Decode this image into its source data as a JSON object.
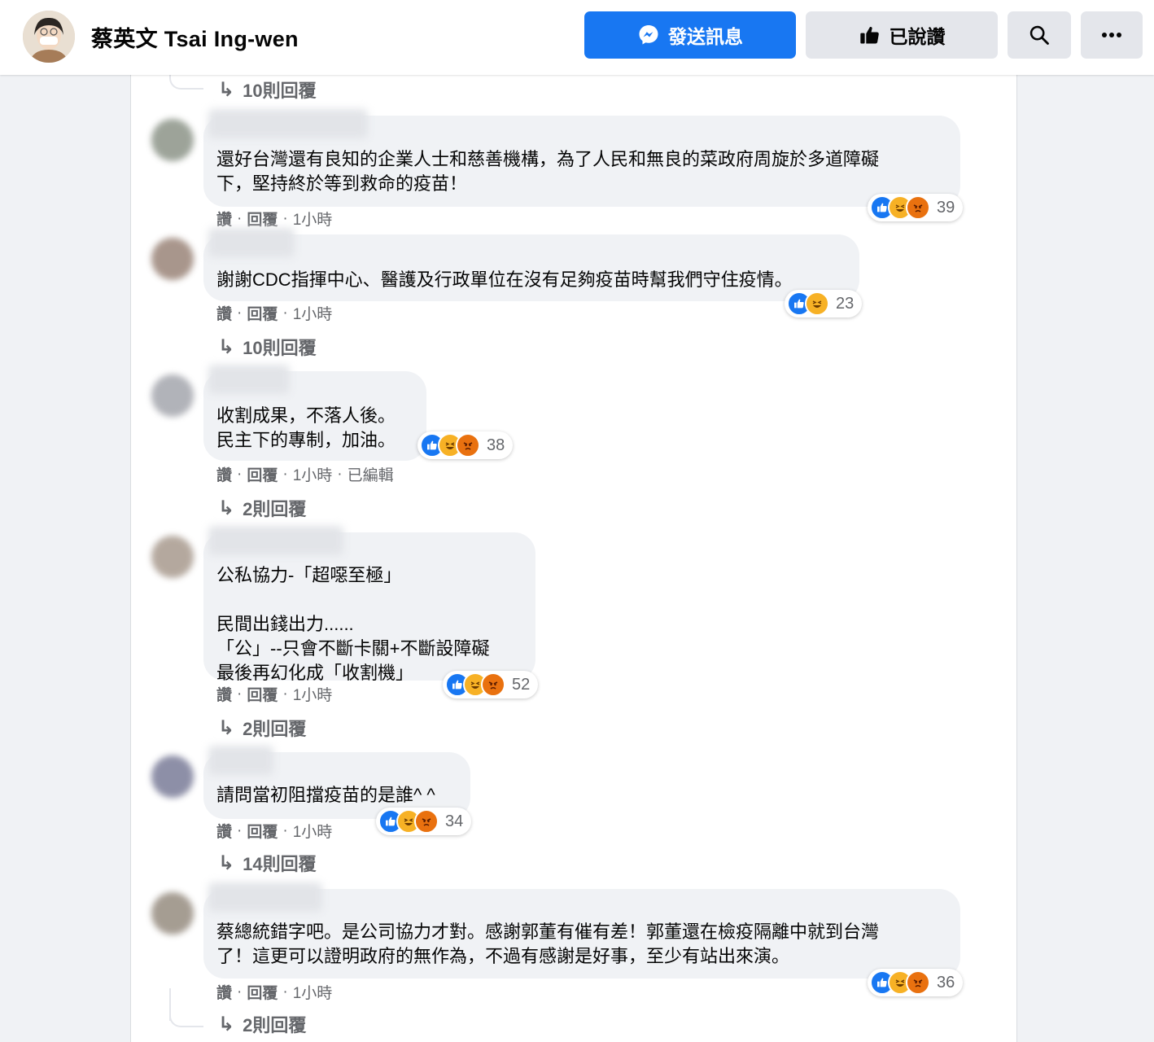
{
  "header": {
    "page_name": "蔡英文 Tsai Ing-wen",
    "message_button": "發送訊息",
    "liked_button": "已說讚",
    "search_icon": "search-icon",
    "more_icon": "more-icon"
  },
  "colors": {
    "accent": "#1877f2",
    "like": "#1877f2",
    "haha": "#f7b125",
    "angry": "#e9710f"
  },
  "top_replies": {
    "label": "10則回覆"
  },
  "comments": [
    {
      "text": "還好台灣還有良知的企業人士和慈善機構，為了人民和無良的菜政府周旋於多道障礙\n下，堅持終於等到救命的疫苗！",
      "reactions": [
        "like",
        "haha",
        "angry"
      ],
      "reaction_count": "39",
      "actions": [
        "讚",
        "回覆"
      ],
      "time": "1小時",
      "edited": "",
      "replies": ""
    },
    {
      "text": "謝謝CDC指揮中心、醫護及行政單位在沒有足夠疫苗時幫我們守住疫情。",
      "reactions": [
        "like",
        "haha"
      ],
      "reaction_count": "23",
      "actions": [
        "讚",
        "回覆"
      ],
      "time": "1小時",
      "edited": "",
      "replies": "10則回覆"
    },
    {
      "text": "收割成果，不落人後。\n民主下的專制，加油。",
      "reactions": [
        "like",
        "haha",
        "angry"
      ],
      "reaction_count": "38",
      "actions": [
        "讚",
        "回覆"
      ],
      "time": "1小時",
      "edited": "已編輯",
      "replies": "2則回覆"
    },
    {
      "text": "公私協力-「超噁至極」\n\n民間出錢出力......\n「公」--只會不斷卡關+不斷設障礙\n最後再幻化成「收割機」",
      "reactions": [
        "like",
        "haha",
        "angry"
      ],
      "reaction_count": "52",
      "actions": [
        "讚",
        "回覆"
      ],
      "time": "1小時",
      "edited": "",
      "replies": "2則回覆"
    },
    {
      "text": "請問當初阻擋疫苗的是誰^ ^",
      "reactions": [
        "like",
        "haha",
        "angry"
      ],
      "reaction_count": "34",
      "actions": [
        "讚",
        "回覆"
      ],
      "time": "1小時",
      "edited": "",
      "replies": "14則回覆"
    },
    {
      "text": "蔡總統錯字吧。是公司協力才對。感謝郭董有催有差！郭董還在檢疫隔離中就到台灣\n了！這更可以證明政府的無作為，不過有感謝是好事，至少有站出來演。",
      "reactions": [
        "like",
        "haha",
        "angry"
      ],
      "reaction_count": "36",
      "actions": [
        "讚",
        "回覆"
      ],
      "time": "1小時",
      "edited": "",
      "replies": "2則回覆"
    }
  ]
}
